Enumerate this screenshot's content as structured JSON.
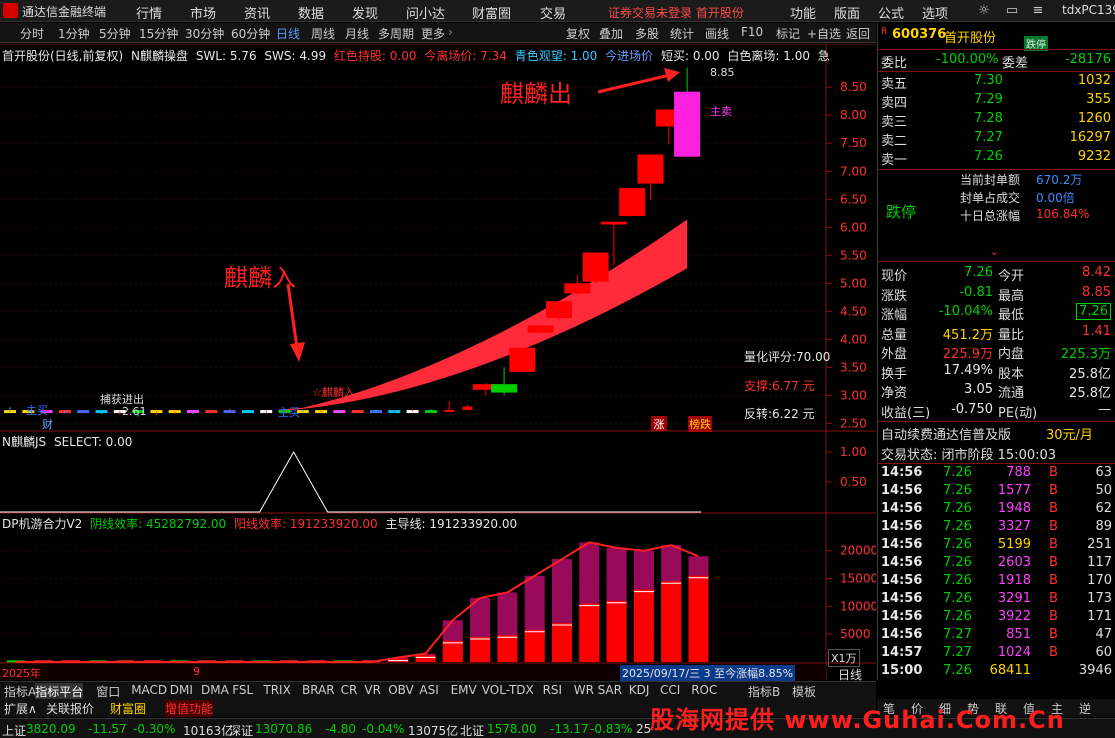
{
  "app": {
    "title": "通达信金融终端"
  },
  "menu": [
    "行情",
    "市场",
    "资讯",
    "数据",
    "发现",
    "问小达",
    "财富圈",
    "交易"
  ],
  "notice": {
    "login": "证券交易未登录",
    "stock": "首开股份"
  },
  "menu_right": [
    "功能",
    "版面",
    "公式",
    "选项"
  ],
  "user": "tdxPC139",
  "toolbar": {
    "periods": [
      "分时",
      "1分钟",
      "5分钟",
      "15分钟",
      "30分钟",
      "60分钟",
      "日线",
      "周线",
      "月线",
      "多周期",
      "更多"
    ],
    "active": "日线",
    "tools": [
      "复权",
      "叠加",
      "多股",
      "统计",
      "画线",
      "F10",
      "标记",
      "+自选",
      "返回"
    ]
  },
  "main_info": {
    "stock": "首开股份(日线,前复权)",
    "indicator": "N麒麟操盘",
    "swl": "SWL: 5.76",
    "sws": "SWS: 4.99",
    "hold": "红色持股: 0.00",
    "leave": "今离场价: 7.34",
    "watch": "青色观望: 1.00",
    "add": "今进场价",
    "short": "短买: 0.00",
    "white": "白色离场: 1.00",
    "more": "急"
  },
  "sub1_info": {
    "name": "N麒麟JS",
    "select": "SELECT: 0.00"
  },
  "sub2_info": {
    "name": "DP机游合力V2",
    "yin": "阴线效率: 45282792.00",
    "yang": "阳线效率: 191233920.00",
    "main": "主导线: 191233920.00"
  },
  "annotations": {
    "exit": "麒麟出",
    "enter": "麒麟入"
  },
  "chart_labels": {
    "high": "8.85",
    "sell": "主卖",
    "score": "量化评分:70.00",
    "support": "支撑:6.77 元",
    "reversal": "反转:6.22 元",
    "low": "2.61",
    "buy1": "主买",
    "buy2": "主买",
    "rise": "涨",
    "list": "榜跌",
    "fin": "财",
    "kl": "☆麒麟入",
    "bo": "捕获进出",
    "year": "2025年",
    "month": "9",
    "range": "2025/09/17/三 3 至今涨幅8.85%",
    "unit": "X1万",
    "daily": "日线"
  },
  "chart_data": [
    {
      "type": "candlestick",
      "y_ticks": [
        "8.50",
        "8.00",
        "7.50",
        "7.00",
        "6.50",
        "6.00",
        "5.50",
        "5.00",
        "4.50",
        "4.00",
        "3.50",
        "3.00",
        "2.50"
      ],
      "ylim": [
        2.4,
        8.95
      ],
      "candles": [
        {
          "o": 2.77,
          "c": 2.72,
          "h": 2.79,
          "l": 2.7
        },
        {
          "o": 2.73,
          "c": 2.7,
          "h": 2.75,
          "l": 2.68
        },
        {
          "o": 2.71,
          "c": 2.72,
          "h": 2.74,
          "l": 2.69
        },
        {
          "o": 2.72,
          "c": 2.7,
          "h": 2.73,
          "l": 2.68
        },
        {
          "o": 2.7,
          "c": 2.71,
          "h": 2.73,
          "l": 2.68
        },
        {
          "o": 2.71,
          "c": 2.69,
          "h": 2.72,
          "l": 2.67
        },
        {
          "o": 2.69,
          "c": 2.7,
          "h": 2.72,
          "l": 2.66
        },
        {
          "o": 2.7,
          "c": 2.68,
          "h": 2.71,
          "l": 2.62
        },
        {
          "o": 2.68,
          "c": 2.7,
          "h": 2.71,
          "l": 2.65
        },
        {
          "o": 2.69,
          "c": 2.7,
          "h": 2.71,
          "l": 2.67
        },
        {
          "o": 2.7,
          "c": 2.69,
          "h": 2.71,
          "l": 2.67
        },
        {
          "o": 2.69,
          "c": 2.7,
          "h": 2.72,
          "l": 2.68
        },
        {
          "o": 2.7,
          "c": 2.72,
          "h": 2.76,
          "l": 2.69
        },
        {
          "o": 2.72,
          "c": 2.7,
          "h": 2.73,
          "l": 2.69
        },
        {
          "o": 2.7,
          "c": 2.71,
          "h": 2.73,
          "l": 2.68
        },
        {
          "o": 2.71,
          "c": 2.72,
          "h": 2.75,
          "l": 2.7
        },
        {
          "o": 2.72,
          "c": 2.71,
          "h": 2.74,
          "l": 2.7
        },
        {
          "o": 2.71,
          "c": 2.72,
          "h": 2.73,
          "l": 2.7
        },
        {
          "o": 2.72,
          "c": 2.7,
          "h": 2.73,
          "l": 2.69
        },
        {
          "o": 2.7,
          "c": 2.72,
          "h": 2.74,
          "l": 2.69
        },
        {
          "o": 2.72,
          "c": 2.71,
          "h": 2.74,
          "l": 2.7
        },
        {
          "o": 2.71,
          "c": 2.72,
          "h": 2.74,
          "l": 2.7
        },
        {
          "o": 2.72,
          "c": 2.73,
          "h": 2.75,
          "l": 2.71
        },
        {
          "o": 2.73,
          "c": 2.72,
          "h": 2.75,
          "l": 2.71
        },
        {
          "o": 2.72,
          "c": 2.74,
          "h": 2.9,
          "l": 2.71
        },
        {
          "o": 2.74,
          "c": 2.8,
          "h": 2.83,
          "l": 2.73
        },
        {
          "o": 3.1,
          "c": 3.2,
          "h": 3.22,
          "l": 3.0
        },
        {
          "o": 3.2,
          "c": 3.05,
          "h": 3.5,
          "l": 3.0
        },
        {
          "o": 3.42,
          "c": 3.85,
          "h": 3.85,
          "l": 3.42
        },
        {
          "o": 4.12,
          "c": 4.25,
          "h": 4.25,
          "l": 4.1
        },
        {
          "o": 4.38,
          "c": 4.68,
          "h": 4.68,
          "l": 4.35
        },
        {
          "o": 4.82,
          "c": 5.0,
          "h": 5.15,
          "l": 4.8
        },
        {
          "o": 5.03,
          "c": 5.55,
          "h": 5.55,
          "l": 5.0
        },
        {
          "o": 6.05,
          "c": 6.1,
          "h": 6.1,
          "l": 5.32
        },
        {
          "o": 6.2,
          "c": 6.7,
          "h": 6.7,
          "l": 6.2
        },
        {
          "o": 6.78,
          "c": 7.3,
          "h": 7.3,
          "l": 6.5
        },
        {
          "o": 7.8,
          "c": 8.1,
          "h": 8.1,
          "l": 7.48
        },
        {
          "o": 8.42,
          "c": 7.26,
          "h": 8.85,
          "l": 7.26
        }
      ]
    },
    {
      "type": "line",
      "y_ticks": [
        "1.00",
        "0.50"
      ],
      "ylim": [
        0,
        1.2
      ],
      "x": [
        0,
        1,
        2,
        3,
        4,
        5,
        6,
        7,
        8,
        9,
        10,
        11,
        12,
        13,
        14,
        15,
        16,
        17,
        18,
        19,
        20,
        21,
        22,
        23,
        24,
        25,
        26,
        27,
        28,
        29,
        30,
        31,
        32,
        33,
        34,
        35,
        36,
        37
      ],
      "values": [
        0,
        0,
        0,
        0,
        0,
        0,
        0,
        0,
        0,
        0,
        0,
        0,
        0,
        0,
        0,
        0,
        0,
        0,
        0,
        0,
        0,
        0,
        0,
        0,
        0,
        0,
        0,
        0,
        0,
        0,
        0,
        0,
        0,
        0,
        0,
        0,
        0,
        0
      ],
      "peak": {
        "x": 15.5,
        "y": 1.0
      }
    },
    {
      "type": "bar",
      "y_ticks": [
        "20000",
        "15000",
        "10000",
        "5000"
      ],
      "ylim": [
        0,
        23000
      ],
      "bars": [
        {
          "total": 0,
          "red": 0
        },
        {
          "total": 0,
          "red": 0
        },
        {
          "total": 0,
          "red": 0
        },
        {
          "total": 0,
          "red": 0
        },
        {
          "total": 0,
          "red": 0
        },
        {
          "total": 0,
          "red": 0
        },
        {
          "total": 0,
          "red": 0
        },
        {
          "total": 0,
          "red": 0
        },
        {
          "total": 0,
          "red": 0
        },
        {
          "total": 0,
          "red": 0
        },
        {
          "total": 0,
          "red": 0
        },
        {
          "total": 0,
          "red": 0
        },
        {
          "total": 0,
          "red": 0
        },
        {
          "total": 0,
          "red": 0
        },
        {
          "total": 800,
          "red": 600
        },
        {
          "total": 1500,
          "red": 1200
        },
        {
          "total": 7500,
          "red": 3800
        },
        {
          "total": 11500,
          "red": 4500
        },
        {
          "total": 12500,
          "red": 4800
        },
        {
          "total": 15500,
          "red": 5800
        },
        {
          "total": 18500,
          "red": 7000
        },
        {
          "total": 21500,
          "red": 10500
        },
        {
          "total": 20500,
          "red": 11000
        },
        {
          "total": 20000,
          "red": 13000
        },
        {
          "total": 21000,
          "red": 14500
        },
        {
          "total": 19000,
          "red": 15500
        }
      ],
      "line": [
        0,
        0,
        0,
        0,
        0,
        0,
        0,
        0,
        0,
        0,
        0,
        0,
        0,
        0,
        800,
        1500,
        7500,
        11500,
        12500,
        15500,
        18500,
        21500,
        20500,
        20000,
        21000,
        19000
      ]
    }
  ],
  "quote": {
    "code": "600376",
    "name": "首开股份",
    "tag": "跌停",
    "wb_label": "委比",
    "wb_val": "-100.00%",
    "wc_label": "委差",
    "wc_val": "-28176",
    "asks": [
      {
        "label": "卖五",
        "price": "7.30",
        "vol": "1032"
      },
      {
        "label": "卖四",
        "price": "7.29",
        "vol": "355"
      },
      {
        "label": "卖三",
        "price": "7.28",
        "vol": "1260"
      },
      {
        "label": "卖二",
        "price": "7.27",
        "vol": "16297"
      },
      {
        "label": "卖一",
        "price": "7.26",
        "vol": "9232"
      }
    ],
    "limit_label": "跌停",
    "seal": [
      {
        "label": "当前封单额",
        "val": "670.2万"
      },
      {
        "label": "封单占成交",
        "val": "0.00倍"
      },
      {
        "label": "十日总涨幅",
        "val": "106.84%"
      }
    ],
    "stats": [
      {
        "l1": "现价",
        "v1": "7.26",
        "l2": "今开",
        "v2": "8.42"
      },
      {
        "l1": "涨跌",
        "v1": "-0.81",
        "l2": "最高",
        "v2": "8.85"
      },
      {
        "l1": "涨幅",
        "v1": "-10.04%",
        "l2": "最低",
        "v2": "7.26"
      },
      {
        "l1": "总量",
        "v1": "451.2万",
        "l2": "量比",
        "v2": "1.41"
      },
      {
        "l1": "外盘",
        "v1": "225.9万",
        "l2": "内盘",
        "v2": "225.3万"
      },
      {
        "l1": "换手",
        "v1": "17.49%",
        "l2": "股本",
        "v2": "25.8亿"
      },
      {
        "l1": "净资",
        "v1": "3.05",
        "l2": "流通",
        "v2": "25.8亿"
      },
      {
        "l1": "收益(三)",
        "v1": "-0.750",
        "l2": "PE(动)",
        "v2": "—"
      }
    ],
    "promo": "自动续费通达信普及版",
    "promo_price": "30元/月",
    "trade_status": "交易状态: 闭市阶段 15:00:03",
    "ticks": [
      {
        "t": "14:56",
        "p": "7.26",
        "v": "788",
        "s": "B",
        "n": "63"
      },
      {
        "t": "14:56",
        "p": "7.26",
        "v": "1577",
        "s": "B",
        "n": "50"
      },
      {
        "t": "14:56",
        "p": "7.26",
        "v": "1948",
        "s": "B",
        "n": "62"
      },
      {
        "t": "14:56",
        "p": "7.26",
        "v": "3327",
        "s": "B",
        "n": "89"
      },
      {
        "t": "14:56",
        "p": "7.26",
        "v": "5199",
        "s": "B",
        "n": "251"
      },
      {
        "t": "14:56",
        "p": "7.26",
        "v": "2603",
        "s": "B",
        "n": "117"
      },
      {
        "t": "14:56",
        "p": "7.26",
        "v": "1918",
        "s": "B",
        "n": "170"
      },
      {
        "t": "14:56",
        "p": "7.26",
        "v": "3291",
        "s": "B",
        "n": "173"
      },
      {
        "t": "14:56",
        "p": "7.26",
        "v": "3922",
        "s": "B",
        "n": "171"
      },
      {
        "t": "14:56",
        "p": "7.27",
        "v": "851",
        "s": "B",
        "n": "47"
      },
      {
        "t": "14:57",
        "p": "7.27",
        "v": "1024",
        "s": "B",
        "n": "60"
      },
      {
        "t": "15:00",
        "p": "7.26",
        "v": "68411",
        "s": "",
        "n": "3946"
      }
    ]
  },
  "bottom_tabs": [
    "指标A",
    "指标平台",
    "窗口",
    "MACD",
    "DMI",
    "DMA",
    "FSL",
    "TRIX",
    "BRAR",
    "CR",
    "VR",
    "OBV",
    "ASI",
    "EMV",
    "VOL-TDX",
    "RSI",
    "WR",
    "SAR",
    "KDJ",
    "CCI",
    "ROC"
  ],
  "bottom_tabs_right": [
    "指标B",
    "模板"
  ],
  "bottom_tabs2": [
    "扩展∧",
    "关联报价",
    "财富圈",
    "增值功能"
  ],
  "right_tabs": [
    "笔",
    "价",
    "细",
    "势",
    "联",
    "值",
    "主",
    "逆"
  ],
  "statusbar": [
    {
      "name": "上证",
      "val": "3820.09",
      "chg": "-11.57",
      "pct": "-0.30%",
      "amt": "10163亿"
    },
    {
      "name": "深证",
      "val": "13070.86",
      "chg": "-4.80",
      "pct": "-0.04%",
      "amt": "13075亿"
    },
    {
      "name": "北证",
      "val": "1578.00",
      "chg": "-13.17",
      "pct": "-0.83%",
      "amt": "25"
    }
  ],
  "watermark": "股海网提供 www.Guhai.Com.Cn",
  "colors": {
    "up": "#ff2020",
    "down": "#00d000",
    "accent": "#ffd400",
    "bg": "#000000"
  }
}
